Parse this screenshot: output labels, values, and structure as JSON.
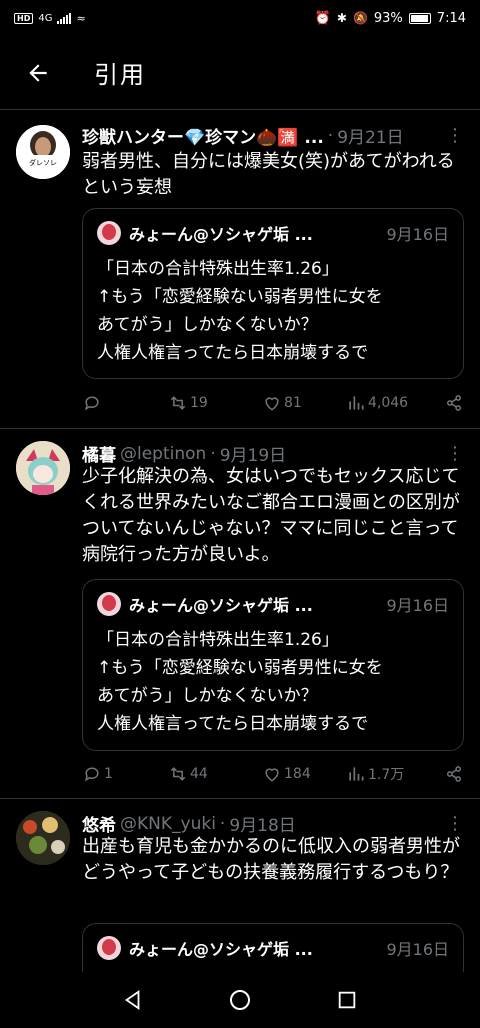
{
  "status_bar": {
    "left_badge": "HD",
    "network": "4G",
    "battery_percent": "93%",
    "battery_level": 0.93,
    "time": "7:14"
  },
  "header": {
    "title": "引用"
  },
  "tweets": [
    {
      "name": "珍獣ハンター💎珍マン🌰🈵 ...",
      "handle": "",
      "date": "9月21日",
      "text": "弱者男性、自分には爆美女(笑)があてがわれるという妄想",
      "avatar_label": "ダレソレ",
      "quote": {
        "name": "みょーん@ソシャゲ垢 ...",
        "date": "9月16日",
        "lines": [
          "「日本の合計特殊出生率1.26」",
          "↑もう「恋愛経験ない弱者男性に女を",
          "あてがう」しかなくないか？",
          "人権人権言ってたら日本崩壊するで"
        ]
      },
      "replies": "",
      "retweets": "19",
      "likes": "81",
      "views": "4,046"
    },
    {
      "name": "橘暮",
      "handle": "@leptinon",
      "date": "9月19日",
      "text": "少子化解決の為、女はいつでもセックス応じてくれる世界みたいなご都合エロ漫画との区別がついてないんじゃない？ママに同じこと言って病院行った方が良いよ。",
      "quote": {
        "name": "みょーん@ソシャゲ垢 ...",
        "date": "9月16日",
        "lines": [
          "「日本の合計特殊出生率1.26」",
          "↑もう「恋愛経験ない弱者男性に女を",
          "あてがう」しかなくないか？",
          "人権人権言ってたら日本崩壊するで"
        ]
      },
      "replies": "1",
      "retweets": "44",
      "likes": "184",
      "views": "1.7万"
    },
    {
      "name": "悠希",
      "handle": "@KNK_yuki",
      "date": "9月18日",
      "text": "出産も育児も金かかるのに低収入の弱者男性がどうやって子どもの扶養義務履行するつもり？",
      "quote": {
        "name": "みょーん@ソシャゲ垢 ...",
        "date": "9月16日"
      }
    }
  ],
  "icons": {
    "back": "arrow-left-icon",
    "more": "more-vertical-icon",
    "reply": "reply-icon",
    "retweet": "retweet-icon",
    "like": "heart-icon",
    "views": "views-icon",
    "share": "share-icon",
    "nav_back": "triangle-back-icon",
    "nav_home": "circle-home-icon",
    "nav_recent": "square-recent-icon"
  },
  "colors": {
    "background": "#000000",
    "text": "#e7e9ea",
    "muted": "#71767b",
    "border": "#2f3336"
  }
}
